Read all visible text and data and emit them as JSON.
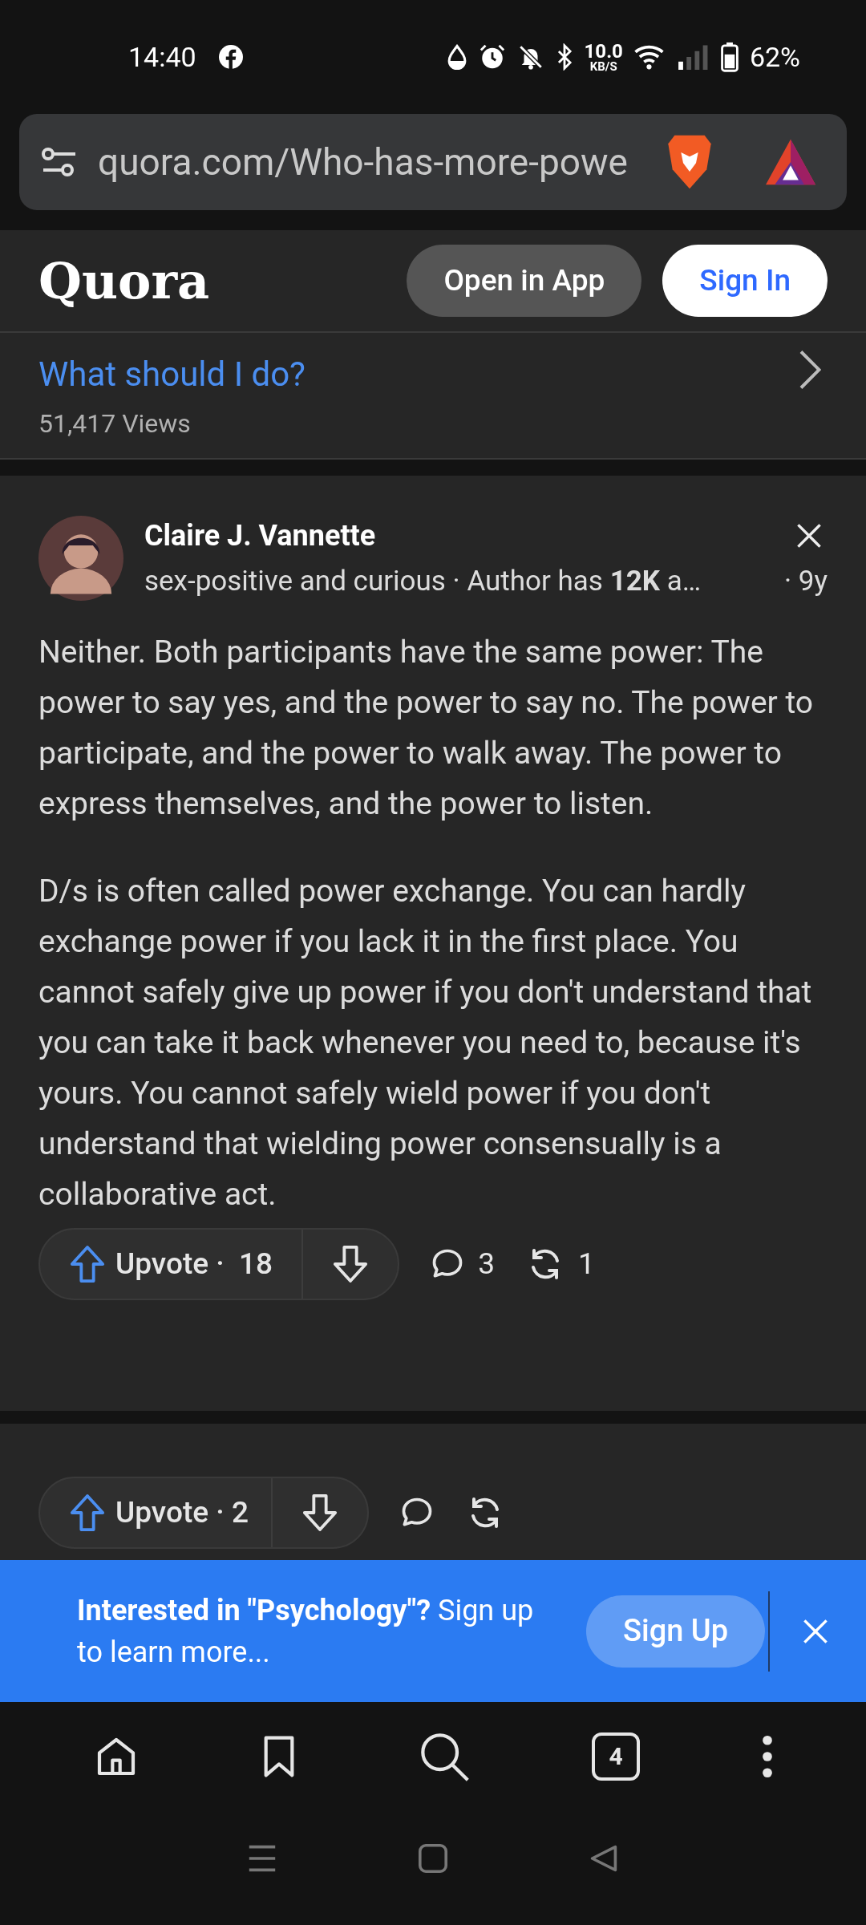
{
  "status_bar": {
    "time": "14:40",
    "net_speed": "10.0",
    "net_unit": "KB/S",
    "battery": "62%"
  },
  "address_bar": {
    "url": "quora.com/Who-has-more-powe"
  },
  "header": {
    "logo": "Quora",
    "buttons": [
      {
        "label": "Open in App",
        "kind": "secondary"
      },
      {
        "label": "Sign In",
        "kind": "primary"
      }
    ]
  },
  "related_question": {
    "title": "What should I do?",
    "views": "51,417 Views"
  },
  "answer": {
    "author": "Claire J. Vannette",
    "credential": "sex-positive and curious · Author has **12K** a…",
    "age": "· 9y",
    "paragraphs": [
      "Neither. Both participants have the same power: The power to say yes, and the power to say no. The power to participate, and the power to walk away. The power to express themselves, and the power to listen.",
      "D/s is often called power exchange. You can hardly exchange power if you lack it in the first place. You cannot safely give up power if you don't understand that you can take it back whenever you need to, because it's yours. You cannot safely wield power if you don't understand that wielding power consensually is a collaborative act."
    ],
    "upvote": "Upvote ·  18",
    "comments": "3",
    "shares": "1"
  },
  "next_answer": {
    "upvote": "Upvote · 2"
  },
  "signup_banner": {
    "text": "**Interested in \"Psychology\"?** Sign up to learn more...",
    "button": "Sign Up"
  },
  "browser_toolbar": {
    "tab_count": "4"
  }
}
